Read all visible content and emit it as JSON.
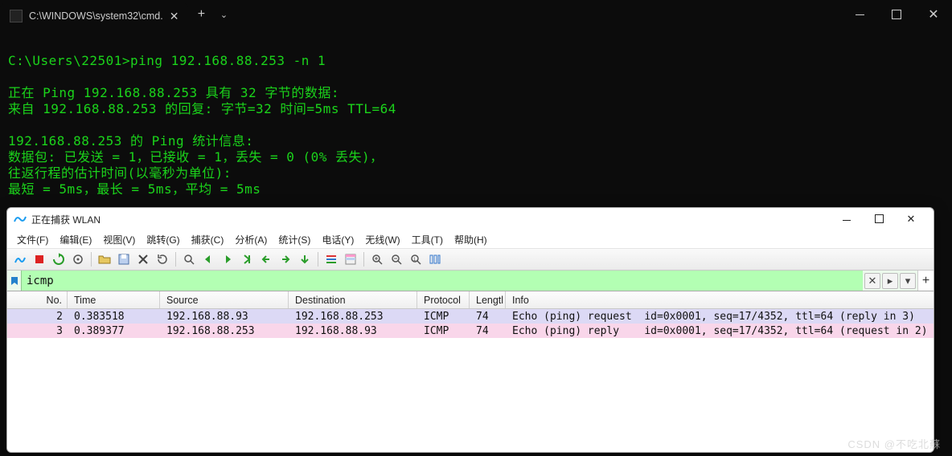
{
  "cmd_tab": {
    "title": "C:\\WINDOWS\\system32\\cmd.",
    "add_label": "+",
    "dropdown_label": "⌄"
  },
  "terminal": {
    "prompt": "C:\\Users\\22501>",
    "command": "ping 192.168.88.253 -n 1",
    "lines": [
      "",
      "正在 Ping 192.168.88.253 具有 32 字节的数据:",
      "来自 192.168.88.253 的回复: 字节=32 时间=5ms TTL=64",
      "",
      "192.168.88.253 的 Ping 统计信息:",
      "    数据包: 已发送 = 1，已接收 = 1，丢失 = 0 (0% 丢失)，",
      "往返行程的估计时间(以毫秒为单位):",
      "    最短 = 5ms，最长 = 5ms，平均 = 5ms"
    ]
  },
  "wireshark": {
    "title": "正在捕获 WLAN",
    "menu": [
      "文件(F)",
      "编辑(E)",
      "视图(V)",
      "跳转(G)",
      "捕获(C)",
      "分析(A)",
      "统计(S)",
      "电话(Y)",
      "无线(W)",
      "工具(T)",
      "帮助(H)"
    ],
    "filter_value": "icmp",
    "filter_clear": "✕",
    "filter_apply": "▸",
    "filter_drop": "▾",
    "filter_add": "+",
    "columns": {
      "no": "No.",
      "time": "Time",
      "src": "Source",
      "dst": "Destination",
      "proto": "Protocol",
      "len": "Lengtl",
      "info": "Info"
    },
    "packets": [
      {
        "no": "2",
        "time": "0.383518",
        "src": "192.168.88.93",
        "dst": "192.168.88.253",
        "proto": "ICMP",
        "len": "74",
        "info": "Echo (ping) request  id=0x0001, seq=17/4352, ttl=64 (reply in 3)",
        "cls": "req"
      },
      {
        "no": "3",
        "time": "0.389377",
        "src": "192.168.88.253",
        "dst": "192.168.88.93",
        "proto": "ICMP",
        "len": "74",
        "info": "Echo (ping) reply    id=0x0001, seq=17/4352, ttl=64 (request in 2)",
        "cls": "reply"
      }
    ]
  },
  "watermark": "CSDN @不吃北蘇"
}
